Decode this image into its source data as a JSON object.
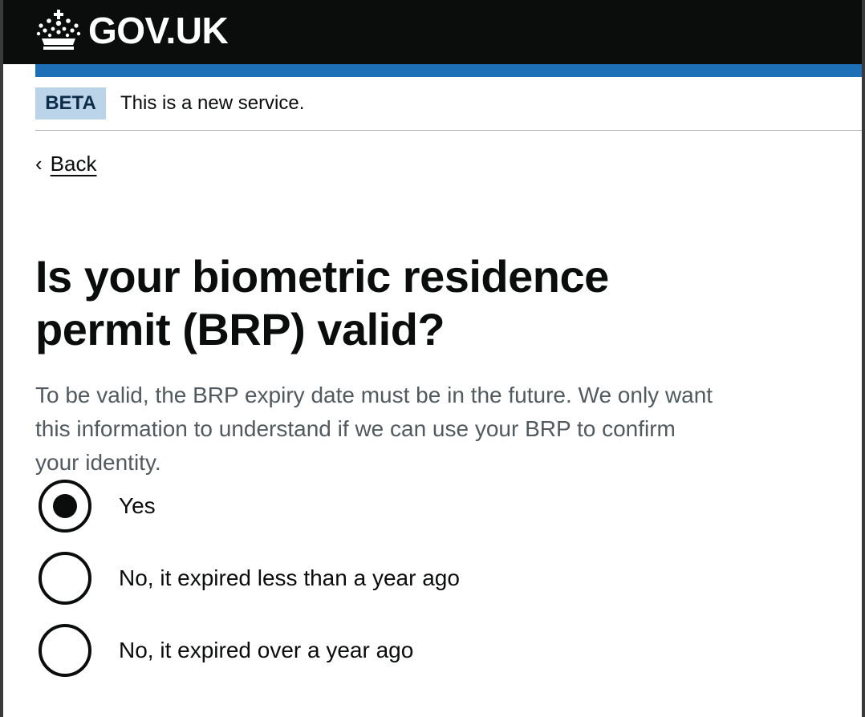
{
  "header": {
    "logo_text": "GOV.UK",
    "logo_icon": "crown-icon"
  },
  "phase_banner": {
    "tag": "BETA",
    "text": "This is a new service."
  },
  "back_link": {
    "label": "Back",
    "icon": "chevron-left-icon"
  },
  "question": {
    "heading": "Is your biometric residence permit (BRP) valid?",
    "hint": "To be valid, the BRP expiry date must be in the future. We only want this information to understand if we can use your BRP to confirm your identity."
  },
  "options": [
    {
      "label": "Yes",
      "selected": true
    },
    {
      "label": "No, it expired less than a year ago",
      "selected": false
    },
    {
      "label": "No, it expired over a year ago",
      "selected": false
    }
  ],
  "colors": {
    "header_bg": "#0b0c0c",
    "brand_blue": "#1d70b8",
    "tag_bg": "#bbd4ea",
    "hint_text": "#505a5f"
  }
}
